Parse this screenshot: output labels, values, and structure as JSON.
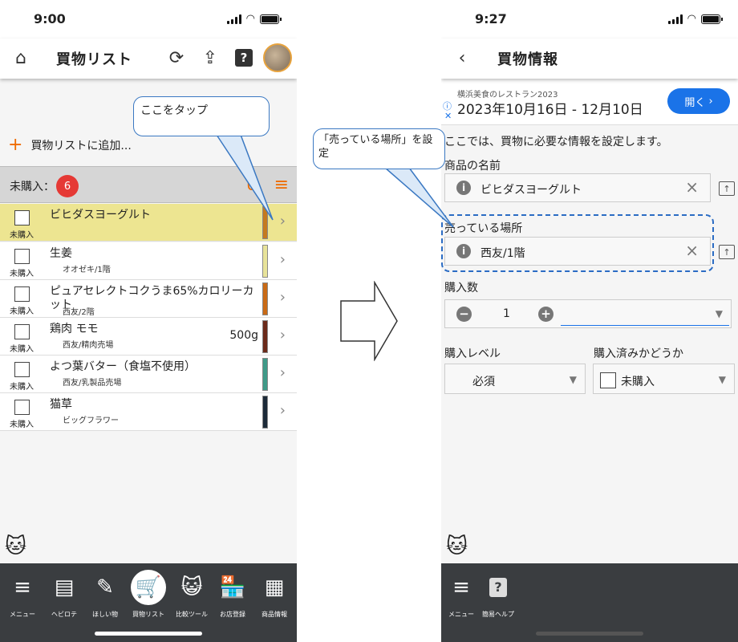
{
  "left": {
    "status": {
      "time": "9:00"
    },
    "title": "買物リスト",
    "add_label": "買物リストに追加...",
    "group": {
      "label": "未購入：",
      "count": "6"
    },
    "callout": "ここをタップ",
    "items": [
      {
        "name": "ビヒダスヨーグルト",
        "sub": "",
        "qty": "",
        "status": "未購入",
        "color": "#c57a1e"
      },
      {
        "name": "生姜",
        "sub": "オオゼキ/1階",
        "qty": "",
        "status": "未購入",
        "color": "#e8e39a"
      },
      {
        "name": "ピュアセレクトコクうま65%カロリーカット",
        "sub": "西友/2階",
        "qty": "",
        "status": "未購入",
        "color": "#c96a15"
      },
      {
        "name": "鶏肉 モモ",
        "sub": "西友/精肉売場",
        "qty": "500g",
        "status": "未購入",
        "color": "#6b2a1a"
      },
      {
        "name": "よつ葉バター（食塩不使用）",
        "sub": "西友/乳製品売場",
        "qty": "",
        "status": "未購入",
        "color": "#3f9a88"
      },
      {
        "name": "猫草",
        "sub": "ビッグフラワー",
        "qty": "",
        "status": "未購入",
        "color": "#1c2a38"
      }
    ],
    "nav": [
      {
        "icon": "menu-icon",
        "label": "メニュー"
      },
      {
        "icon": "hebirote-icon",
        "label": "ヘビロテ"
      },
      {
        "icon": "wishlist-icon",
        "label": "ほしい物"
      },
      {
        "icon": "cart-icon",
        "label": "買物リスト"
      },
      {
        "icon": "compare-icon",
        "label": "比較ツール"
      },
      {
        "icon": "store-icon",
        "label": "お店登録"
      },
      {
        "icon": "product-icon",
        "label": "商品情報"
      }
    ]
  },
  "right": {
    "status": {
      "time": "9:27"
    },
    "title": "買物情報",
    "ad": {
      "line1": "横浜美食のレストラン2023",
      "line2": "2023年10月16日 - 12月10日",
      "button": "開く"
    },
    "intro": "ここでは、買物に必要な情報を設定します。",
    "name_label": "商品の名前",
    "name_value": "ビヒダスヨーグルト",
    "place_label": "売っている場所",
    "place_value": "西友/1階",
    "qty_label": "購入数",
    "qty_value": "1",
    "level_label": "購入レベル",
    "level_value": "必須",
    "done_label": "購入済みかどうか",
    "done_value": "未購入",
    "callout": "「売っている場所」を設定",
    "nav": [
      {
        "icon": "menu-icon",
        "label": "メニュー"
      },
      {
        "icon": "help-icon",
        "label": "簡易ヘルプ"
      }
    ]
  }
}
